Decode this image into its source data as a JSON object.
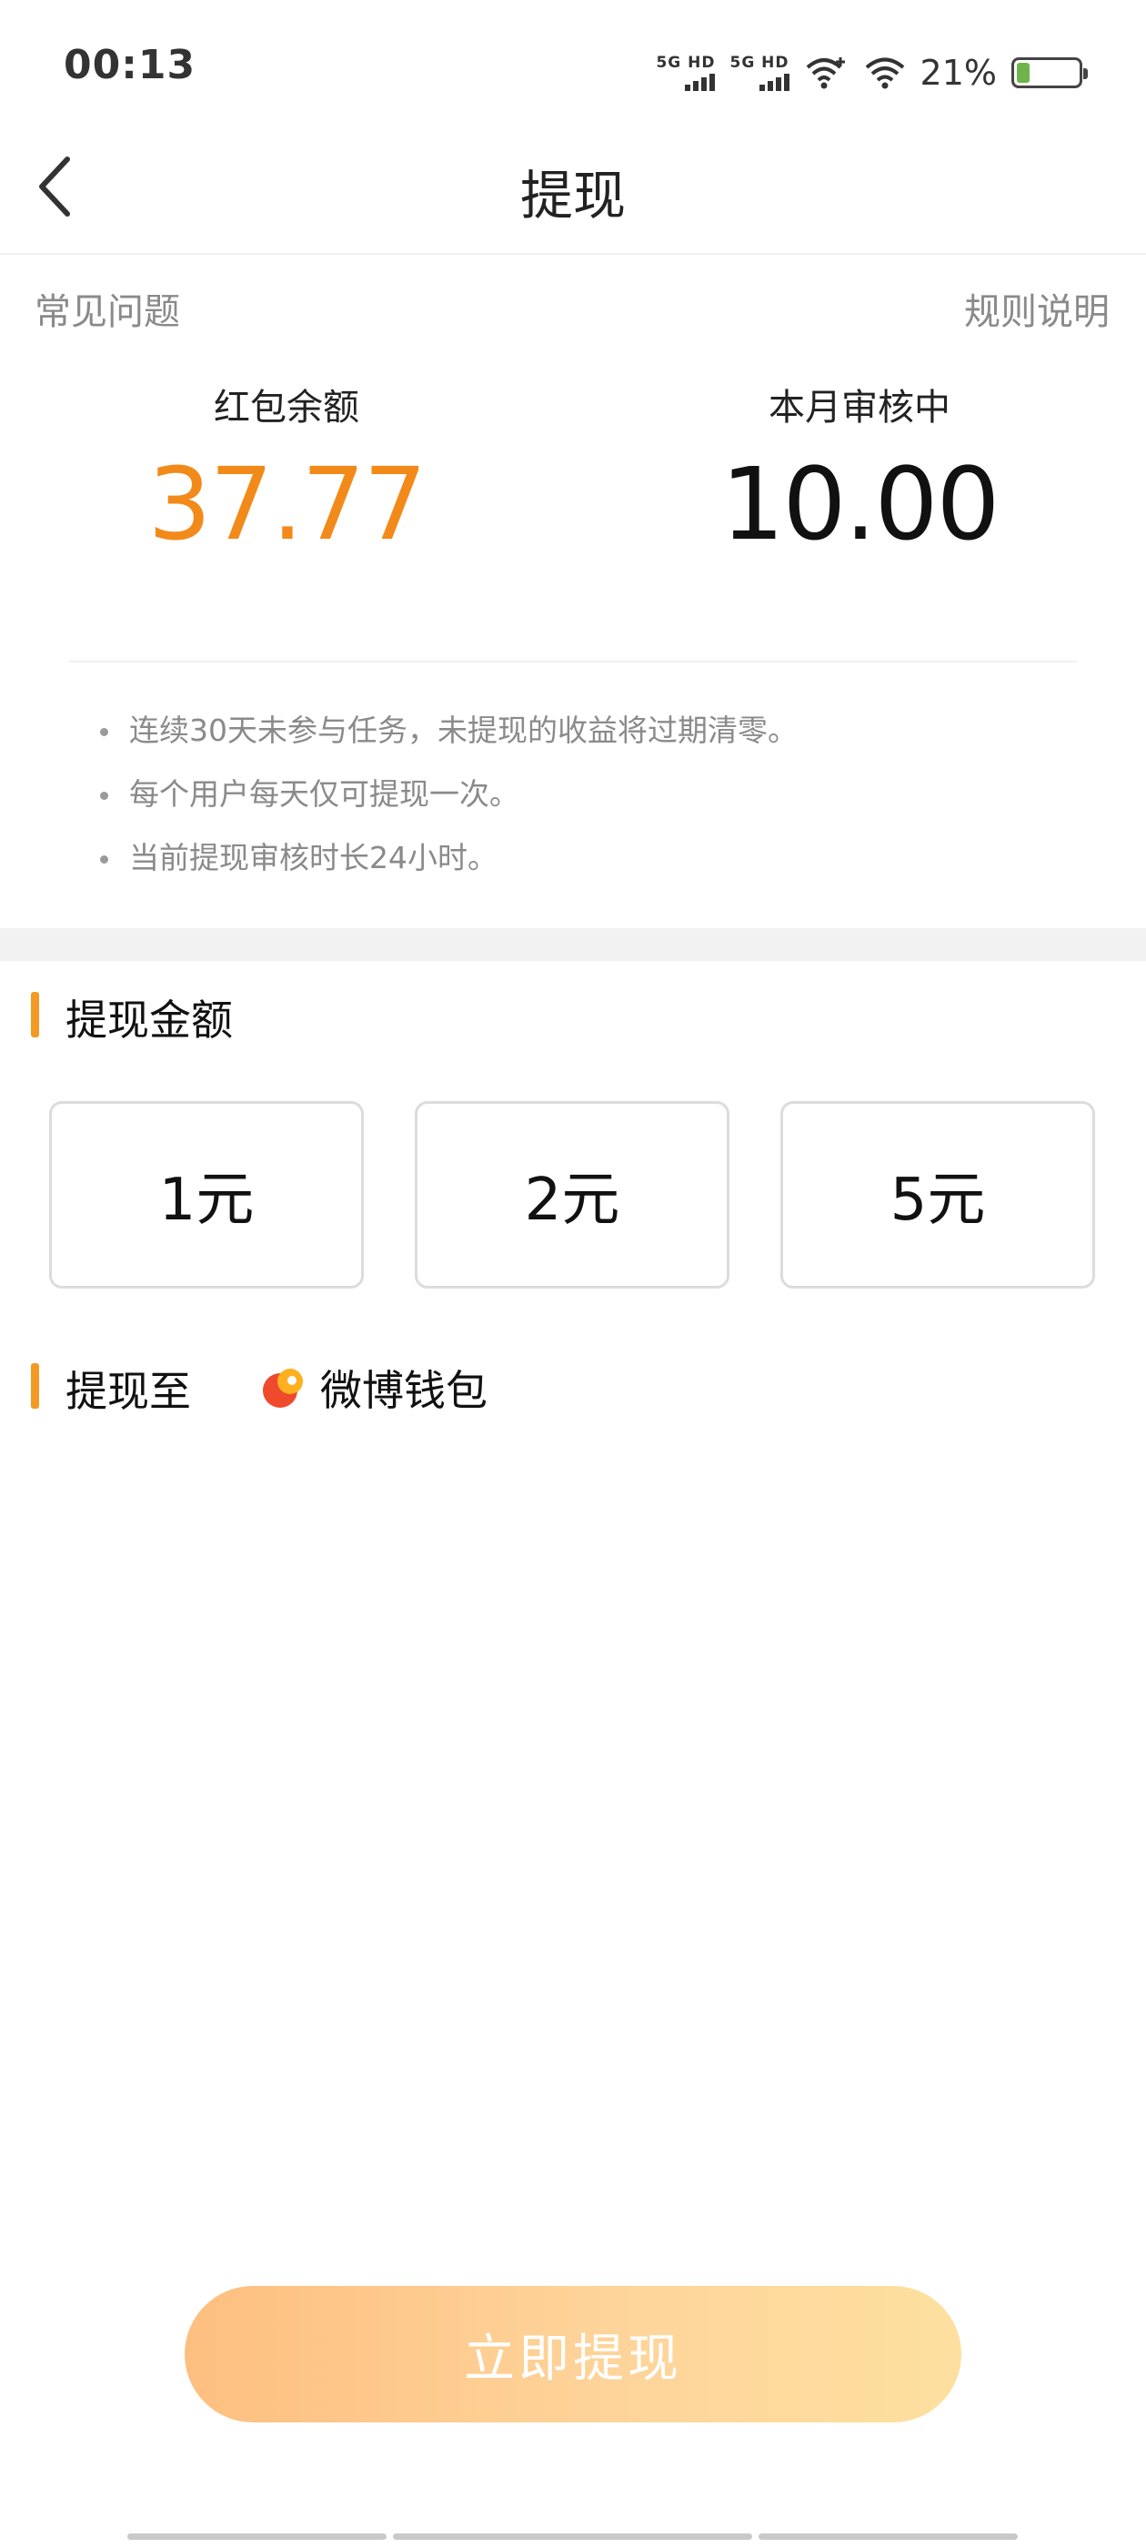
{
  "status_bar": {
    "time": "00:13",
    "signal1_label": "5G HD",
    "signal2_label": "5G HD",
    "battery_percent": "21%",
    "battery_level": 0.21,
    "icons": [
      "signal-5g-hd-icon",
      "signal-5g-hd-icon",
      "wifi-plus-icon",
      "wifi-icon",
      "battery-icon"
    ]
  },
  "nav": {
    "back_icon": "chevron-left-icon",
    "title": "提现"
  },
  "links": {
    "faq": "常见问题",
    "rules": "规则说明"
  },
  "stats": {
    "balance_label": "红包余额",
    "balance_value": "37.77",
    "review_label": "本月审核中",
    "review_value": "10.00"
  },
  "notes": [
    "连续30天未参与任务，未提现的收益将过期清零。",
    "每个用户每天仅可提现一次。",
    "当前提现审核时长24小时。"
  ],
  "amount_section": {
    "title": "提现金额",
    "options": [
      "1元",
      "2元",
      "5元"
    ]
  },
  "destination": {
    "label": "提现至",
    "wallet_name": "微博钱包",
    "wallet_icon": "weibo-wallet-icon"
  },
  "submit_label": "立即提现",
  "colors": {
    "accent": "#f28a1a",
    "section_marker": "#f29a24",
    "button_gradient_start": "#fdbf80",
    "button_gradient_end": "#fde0a0"
  }
}
